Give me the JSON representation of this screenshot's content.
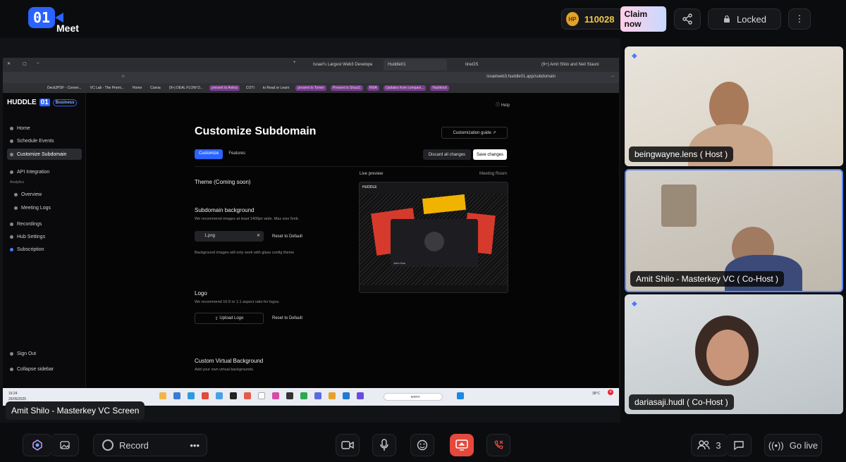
{
  "app": {
    "logo_badge": "01",
    "logo_text": "Meet",
    "points": "110028",
    "coin_label": "HP",
    "claim": "Claim now",
    "locked": "Locked"
  },
  "browser": {
    "tabs": [
      "Israel's Largest Web3 Develope",
      "Huddle01",
      "tineOS",
      "(9+) Amit Shilo and Neil Stauni"
    ],
    "url": "israelweb3.huddle01.app/subdomain",
    "bookmarks": [
      "Deck2PDF - Conver...",
      "VC Lab - The Premi...",
      "Home",
      "Canva",
      "(9+) DEAL FLOW D...",
      "present to Avihai",
      "COTI",
      "to Read or Learn",
      "present to Tomer",
      "Present to Shaul1",
      "RWA",
      "Updates from compani...",
      "Hashlock"
    ]
  },
  "huddle": {
    "logo": "HUDDLE",
    "logo_num": "01",
    "business": "Business",
    "help": "Help",
    "nav": [
      "Home",
      "Schedule Events",
      "Customize Subdomain",
      "API Integration"
    ],
    "analytics": "Analytics",
    "subnav": [
      "Overview",
      "Meeting Logs"
    ],
    "nav2": [
      "Recordings",
      "Hub Settings",
      "Subscription"
    ],
    "signout": "Sign Out",
    "collapse": "Collapse sidebar",
    "title": "Customize Subdomain",
    "tab_customize": "Customize",
    "tab_features": "Features",
    "guide": "Customization guide",
    "discard": "Discard all changes",
    "save": "Save changes",
    "theme": "Theme (Coming soon)",
    "bg_title": "Subdomain background",
    "bg_sub": "We recommend images at least 1400px wide. Max size 5mb.",
    "file": "1.png",
    "reset": "Reset to Default",
    "bg_note": "Background images will only work with glass config theme",
    "logo_title": "Logo",
    "logo_sub": "We recommend 16:9 or 1:1 aspect ratio for logos.",
    "upload": "Upload Logo",
    "cvb_title": "Custom Virtual Background",
    "cvb_sub": "Add your own virtual backgrounds.",
    "live_preview": "Live preview",
    "meeting_room": "Meeting Room",
    "preview_name": "John Doe"
  },
  "taskbar": {
    "time": "16:24",
    "date": "26/05/2025",
    "search": "חיפוש",
    "temp": "38°C",
    "badge": "4"
  },
  "screen_label": "Amit Shilo - Masterkey VC Screen",
  "participants": [
    {
      "name": "beingwayne.lens ( Host )"
    },
    {
      "name": "Amit Shilo - Masterkey VC ( Co-Host )"
    },
    {
      "name": "dariasaji.hudl ( Co-Host )"
    }
  ],
  "bottom": {
    "record": "Record",
    "count": "3",
    "golive": "Go live"
  }
}
